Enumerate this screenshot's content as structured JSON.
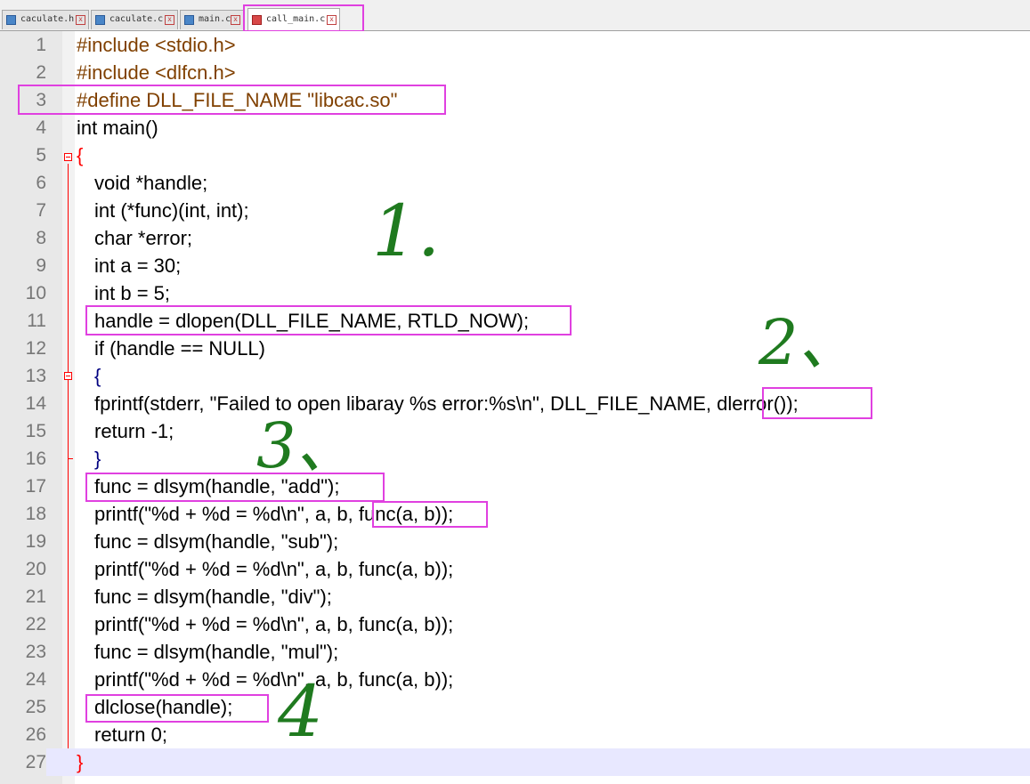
{
  "tabs": [
    {
      "label": "caculate.h",
      "active": false
    },
    {
      "label": "caculate.c",
      "active": false
    },
    {
      "label": "main.c",
      "active": false
    },
    {
      "label": "call_main.c",
      "active": true
    }
  ],
  "editor": {
    "line_numbers": [
      "1",
      "2",
      "3",
      "4",
      "5",
      "6",
      "7",
      "8",
      "9",
      "10",
      "11",
      "12",
      "13",
      "14",
      "15",
      "16",
      "17",
      "18",
      "19",
      "20",
      "21",
      "22",
      "23",
      "24",
      "25",
      "26",
      "27"
    ],
    "current_line": "27",
    "lines": [
      "#include <stdio.h>",
      "#include <dlfcn.h>",
      "#define DLL_FILE_NAME \"libcac.so\"",
      "int main()",
      "{",
      "void *handle;",
      "int (*func)(int, int);",
      "char *error;",
      "int a = 30;",
      "int b = 5;",
      "handle = dlopen(DLL_FILE_NAME, RTLD_NOW);",
      "if (handle == NULL)",
      "{",
      "fprintf(stderr, \"Failed to open libaray %s error:%s\\n\", DLL_FILE_NAME, dlerror());",
      "return -1;",
      "}",
      "func = dlsym(handle, \"add\");",
      "printf(\"%d + %d = %d\\n\", a, b, func(a, b));",
      "func = dlsym(handle, \"sub\");",
      "printf(\"%d + %d = %d\\n\", a, b, func(a, b));",
      "func = dlsym(handle, \"div\");",
      "printf(\"%d + %d = %d\\n\", a, b, func(a, b));",
      "func = dlsym(handle, \"mul\");",
      "printf(\"%d + %d = %d\\n\", a, b, func(a, b));",
      "dlclose(handle);",
      "return 0;",
      "}"
    ]
  },
  "annotations": {
    "step1": "1.",
    "step2": "2、",
    "step3": "3、",
    "step4": "4"
  },
  "colors": {
    "highlight_box": "#e040e0",
    "annotation_ink": "#1f7a1f",
    "preprocessor": "#804000",
    "keyword": "#0000ff",
    "type": "#8000ff",
    "number": "#ff8000",
    "string": "#808080",
    "current_line_bg": "#e8e8ff"
  }
}
